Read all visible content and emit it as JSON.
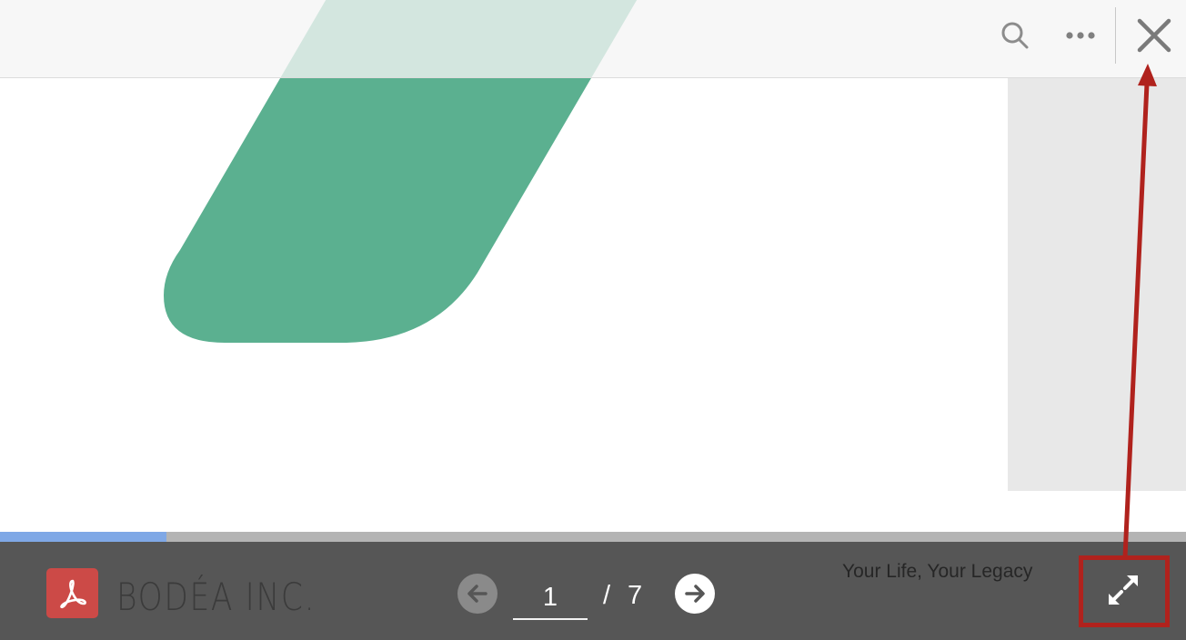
{
  "toolbar": {
    "search_icon": "search-icon",
    "more_icon": "more-options-icon",
    "close_icon": "close-icon"
  },
  "document": {
    "accent_color": "#5bb090",
    "current_page": "1",
    "page_separator": "/",
    "total_pages": "7",
    "scroll_progress_fraction": 0.14
  },
  "footer": {
    "logo_icon": "acrobat-pdf-icon",
    "logo_color": "#cc4a47",
    "brand_name": "BODÉA INC.",
    "tagline": "Your Life, Your Legacy",
    "prev_icon": "arrow-left-icon",
    "next_icon": "arrow-right-icon",
    "fullscreen_icon": "expand-icon",
    "bar_color": "#565656"
  },
  "annotation": {
    "color": "#b0221d"
  }
}
